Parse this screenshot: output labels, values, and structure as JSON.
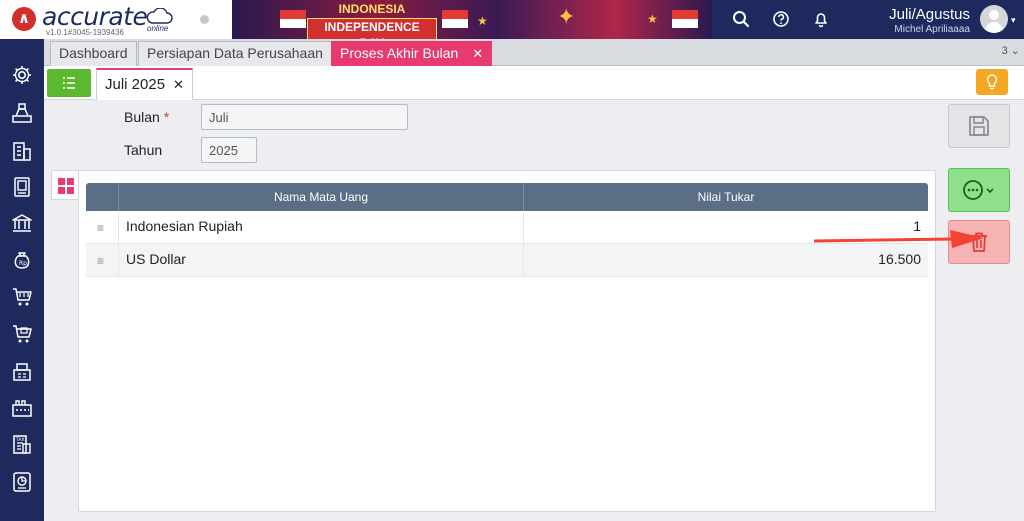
{
  "header": {
    "logo_text": "accurate",
    "logo_sub": "online",
    "version": "v1.0.1#3045-1939436",
    "banner_line1": "INDONESIA",
    "banner_line2": "INDEPENDENCE DAY",
    "period": "Juli/Agustus",
    "user": "Michel Apriliaaaa"
  },
  "tabs": [
    {
      "label": "Dashboard"
    },
    {
      "label": "Persiapan Data Perusahaan"
    },
    {
      "label": "Proses Akhir Bulan"
    }
  ],
  "tab_count": "3",
  "subtab": {
    "label": "Juli 2025"
  },
  "form": {
    "bulan_label": "Bulan",
    "bulan_value": "Juli",
    "tahun_label": "Tahun",
    "tahun_value": "2025"
  },
  "table": {
    "columns": [
      "Nama Mata Uang",
      "Nilai Tukar"
    ],
    "rows": [
      {
        "name": "Indonesian Rupiah",
        "value": "1"
      },
      {
        "name": "US Dollar",
        "value": "16.500"
      }
    ]
  },
  "colors": {
    "brand_navy": "#1e2a5e",
    "accent_pink": "#e73a6f",
    "green": "#5cb82e",
    "danger": "#e53935"
  },
  "icons": {
    "sidebar": [
      "gear-icon",
      "scale-icon",
      "building-icon",
      "ledger-icon",
      "bank-icon",
      "money-bag-icon",
      "cart-icon",
      "sales-cart-icon",
      "warehouse-icon",
      "factory-icon",
      "tax-icon",
      "report-icon"
    ]
  }
}
